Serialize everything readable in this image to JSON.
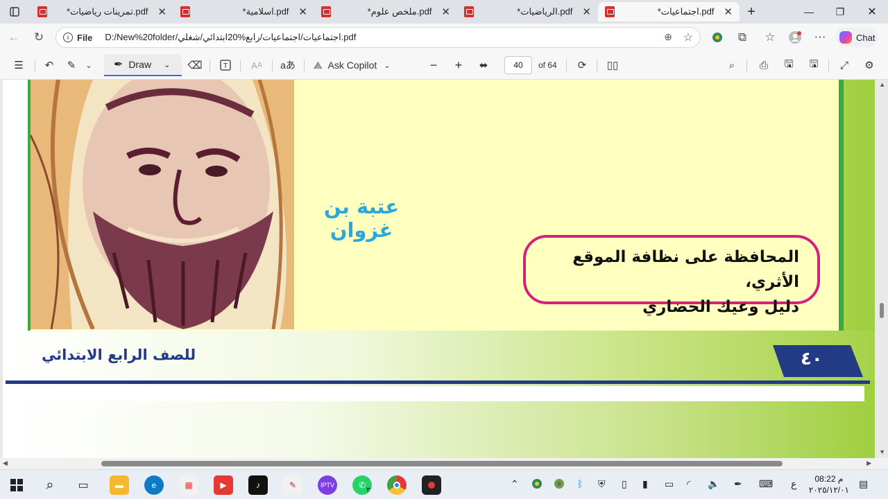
{
  "browser": {
    "tabs": [
      {
        "title": "*تمرينات رياضيات.pdf",
        "active": false
      },
      {
        "title": "*اسلامية.pdf",
        "active": false
      },
      {
        "title": "*ملخص علوم.pdf",
        "active": false
      },
      {
        "title": "*الرياضيات.pdf",
        "active": false
      },
      {
        "title": "*اجتماعيات.pdf",
        "active": true
      }
    ],
    "address": {
      "scheme_label": "File",
      "url": "D:/New%20folder/اجتماعيات/اجتماعيات/رابع%20ابتدائي/شغلي.pdf"
    },
    "chat_label": "Chat"
  },
  "pdf_toolbar": {
    "draw_label": "Draw",
    "ask_copilot_label": "Ask Copilot",
    "page_number": "40",
    "page_count_label": "of 64"
  },
  "page": {
    "figure_name": "عتبة بن غزوان",
    "quote_line1": "المحافظة على نظافة الموقع الأثري،",
    "quote_line2": "دليل وعيك الحضاري",
    "grade_label": "للصف الرابع الابتدائي",
    "page_number_arabic": "٤٠",
    "colors": {
      "navy": "#233a84",
      "pink": "#d6217a",
      "cyan": "#29a8de",
      "green": "#3aa844",
      "yellow": "#ffffc0"
    }
  },
  "taskbar": {
    "clock_time": "08:22 م",
    "clock_date": "٢٠٢٥/١٢/٠١",
    "lang_indicator": "ع",
    "whatsapp_badge": "٣",
    "icons": [
      "windows-start-icon",
      "search-icon",
      "task-view-icon",
      "file-explorer-icon",
      "edge-icon",
      "store-icon",
      "youtube-icon",
      "tiktok-icon",
      "paint-icon",
      "iptv-icon",
      "whatsapp-icon",
      "chrome-icon",
      "screen-recorder-icon"
    ]
  }
}
